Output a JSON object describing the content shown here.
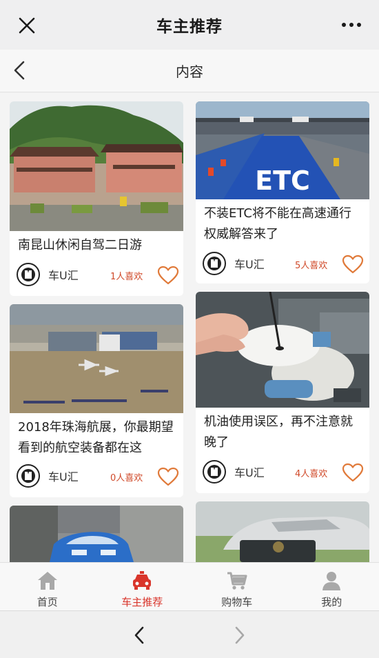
{
  "header": {
    "title": "车主推荐"
  },
  "subheader": {
    "title": "内容"
  },
  "cards": [
    {
      "title": "南昆山休闲自驾二日游",
      "author": "车U汇",
      "likes": "1人喜欢"
    },
    {
      "title": "不装ETC将不能在高速通行 权威解答来了",
      "author": "车U汇",
      "likes": "5人喜欢",
      "image_text": "ETC"
    },
    {
      "title": "2018年珠海航展，你最期望看到的航空装备都在这",
      "author": "车U汇",
      "likes": "0人喜欢"
    },
    {
      "title": "机油使用误区，再不注意就晚了",
      "author": "车U汇",
      "likes": "4人喜欢"
    }
  ],
  "tabs": [
    {
      "label": "首页",
      "icon": "home-icon",
      "active": false
    },
    {
      "label": "车主推荐",
      "icon": "car-icon",
      "active": true
    },
    {
      "label": "购物车",
      "icon": "cart-icon",
      "active": false
    },
    {
      "label": "我的",
      "icon": "user-icon",
      "active": false
    }
  ],
  "colors": {
    "accent": "#d9352b",
    "likes_text": "#d04a2a",
    "heart": "#e07a3a"
  }
}
